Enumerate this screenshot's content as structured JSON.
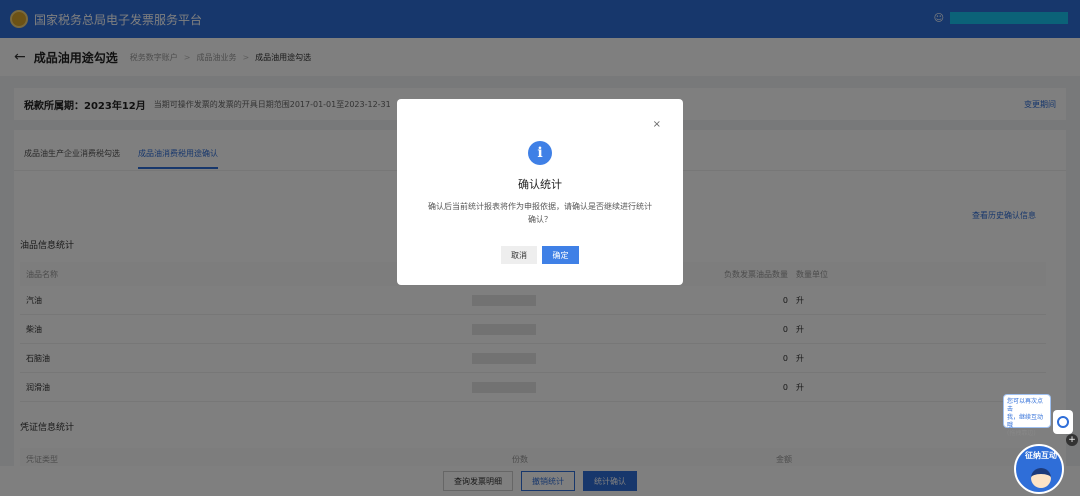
{
  "header": {
    "title": "国家税务总局电子发票服务平台",
    "user_icon": "user-icon"
  },
  "crumbbar": {
    "page_title": "成品油用途勾选",
    "crumbs": [
      "税务数字账户",
      "成品油业务",
      "成品油用途勾选"
    ]
  },
  "period": {
    "label": "税款所属期：2023年12月",
    "desc": "当期可操作发票的发票的开具日期范围2017-01-01至2023-12-31",
    "link": "变更期间"
  },
  "tabs": [
    "成品油生产企业消费税勾选",
    "成品油消费税用途确认"
  ],
  "history_link": "查看历史确认信息",
  "oil_section": {
    "title": "油品信息统计",
    "headers": {
      "name": "油品名称",
      "count": "负数发票油品数量",
      "unit": "数量单位"
    },
    "rows": [
      {
        "name": "汽油",
        "count": "0",
        "unit": "升"
      },
      {
        "name": "柴油",
        "count": "0",
        "unit": "升"
      },
      {
        "name": "石脑油",
        "count": "0",
        "unit": "升"
      },
      {
        "name": "润滑油",
        "count": "0",
        "unit": "升"
      }
    ]
  },
  "voucher_section": {
    "title": "凭证信息统计",
    "headers": {
      "type": "凭证类型",
      "copies": "份数",
      "amount": "金额"
    }
  },
  "footer": {
    "btn_query": "查询发票明细",
    "btn_cancel_stat": "撤销统计",
    "btn_confirm_stat": "统计确认"
  },
  "modal": {
    "close": "×",
    "icon": "i",
    "title": "确认统计",
    "message": "确认后当前统计报表将作为申报依据，请确认是否继续进行统计确认？",
    "cancel": "取消",
    "ok": "确定"
  },
  "chat": {
    "line1": "您可以再次点击",
    "line2": "我，继续互动哦",
    "line3": "(拖拽靠边)",
    "plus": "+",
    "mascot": "征纳互动"
  },
  "colors": {
    "primary": "#2f6ed8",
    "user_name_bar": "#17c4f0"
  }
}
